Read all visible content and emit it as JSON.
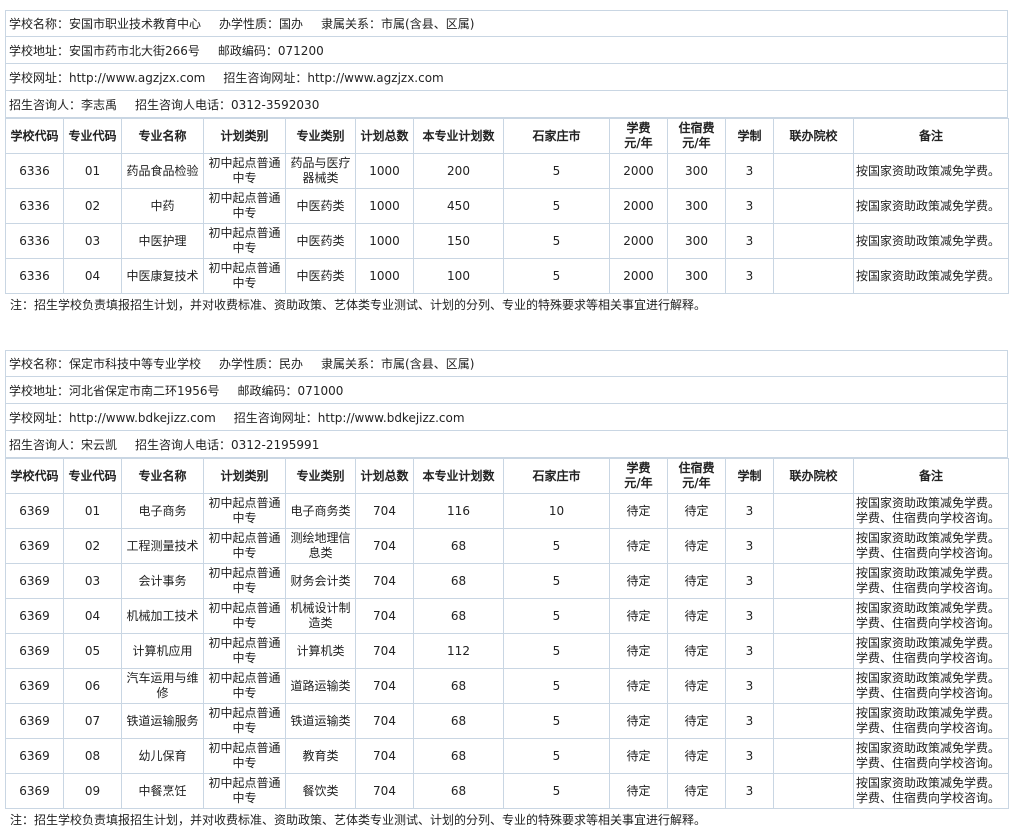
{
  "columns": [
    "学校代码",
    "专业代码",
    "专业名称",
    "计划类别",
    "专业类别",
    "计划总数",
    "本专业计划数",
    "石家庄市",
    "学费\n元/年",
    "住宿费\n元/年",
    "学制",
    "联办院校",
    "备注"
  ],
  "schools": [
    {
      "info": [
        [
          "学校名称：安国市职业技术教育中心",
          "办学性质：国办",
          "隶属关系：市属(含县、区属)"
        ],
        [
          "学校地址：安国市药市北大街266号",
          "邮政编码：071200"
        ],
        [
          "学校网址：http://www.agzjzx.com",
          "招生咨询网址：http://www.agzjzx.com"
        ],
        [
          "招生咨询人：李志禹",
          "招生咨询人电话：0312-3592030"
        ]
      ],
      "rows": [
        [
          "6336",
          "01",
          "药品食品检验",
          "初中起点普通中专",
          "药品与医疗器械类",
          "1000",
          "200",
          "5",
          "2000",
          "300",
          "3",
          "",
          "按国家资助政策减免学费。"
        ],
        [
          "6336",
          "02",
          "中药",
          "初中起点普通中专",
          "中医药类",
          "1000",
          "450",
          "5",
          "2000",
          "300",
          "3",
          "",
          "按国家资助政策减免学费。"
        ],
        [
          "6336",
          "03",
          "中医护理",
          "初中起点普通中专",
          "中医药类",
          "1000",
          "150",
          "5",
          "2000",
          "300",
          "3",
          "",
          "按国家资助政策减免学费。"
        ],
        [
          "6336",
          "04",
          "中医康复技术",
          "初中起点普通中专",
          "中医药类",
          "1000",
          "100",
          "5",
          "2000",
          "300",
          "3",
          "",
          "按国家资助政策减免学费。"
        ]
      ],
      "footnote": "注：招生学校负责填报招生计划，并对收费标准、资助政策、艺体类专业测试、计划的分列、专业的特殊要求等相关事宜进行解释。"
    },
    {
      "info": [
        [
          "学校名称：保定市科技中等专业学校",
          "办学性质：民办",
          "隶属关系：市属(含县、区属)"
        ],
        [
          "学校地址：河北省保定市南二环1956号",
          "邮政编码：071000"
        ],
        [
          "学校网址：http://www.bdkejizz.com",
          "招生咨询网址：http://www.bdkejizz.com"
        ],
        [
          "招生咨询人：宋云凯",
          "招生咨询人电话：0312-2195991"
        ]
      ],
      "rows": [
        [
          "6369",
          "01",
          "电子商务",
          "初中起点普通中专",
          "电子商务类",
          "704",
          "116",
          "10",
          "待定",
          "待定",
          "3",
          "",
          "按国家资助政策减免学费。\n学费、住宿费向学校咨询。"
        ],
        [
          "6369",
          "02",
          "工程测量技术",
          "初中起点普通中专",
          "测绘地理信息类",
          "704",
          "68",
          "5",
          "待定",
          "待定",
          "3",
          "",
          "按国家资助政策减免学费。\n学费、住宿费向学校咨询。"
        ],
        [
          "6369",
          "03",
          "会计事务",
          "初中起点普通中专",
          "财务会计类",
          "704",
          "68",
          "5",
          "待定",
          "待定",
          "3",
          "",
          "按国家资助政策减免学费。\n学费、住宿费向学校咨询。"
        ],
        [
          "6369",
          "04",
          "机械加工技术",
          "初中起点普通中专",
          "机械设计制造类",
          "704",
          "68",
          "5",
          "待定",
          "待定",
          "3",
          "",
          "按国家资助政策减免学费。\n学费、住宿费向学校咨询。"
        ],
        [
          "6369",
          "05",
          "计算机应用",
          "初中起点普通中专",
          "计算机类",
          "704",
          "112",
          "5",
          "待定",
          "待定",
          "3",
          "",
          "按国家资助政策减免学费。\n学费、住宿费向学校咨询。"
        ],
        [
          "6369",
          "06",
          "汽车运用与维修",
          "初中起点普通中专",
          "道路运输类",
          "704",
          "68",
          "5",
          "待定",
          "待定",
          "3",
          "",
          "按国家资助政策减免学费。\n学费、住宿费向学校咨询。"
        ],
        [
          "6369",
          "07",
          "铁道运输服务",
          "初中起点普通中专",
          "铁道运输类",
          "704",
          "68",
          "5",
          "待定",
          "待定",
          "3",
          "",
          "按国家资助政策减免学费。\n学费、住宿费向学校咨询。"
        ],
        [
          "6369",
          "08",
          "幼儿保育",
          "初中起点普通中专",
          "教育类",
          "704",
          "68",
          "5",
          "待定",
          "待定",
          "3",
          "",
          "按国家资助政策减免学费。\n学费、住宿费向学校咨询。"
        ],
        [
          "6369",
          "09",
          "中餐烹饪",
          "初中起点普通中专",
          "餐饮类",
          "704",
          "68",
          "5",
          "待定",
          "待定",
          "3",
          "",
          "按国家资助政策减免学费。\n学费、住宿费向学校咨询。"
        ]
      ],
      "footnote": "注：招生学校负责填报招生计划，并对收费标准、资助政策、艺体类专业测试、计划的分列、专业的特殊要求等相关事宜进行解释。"
    }
  ]
}
